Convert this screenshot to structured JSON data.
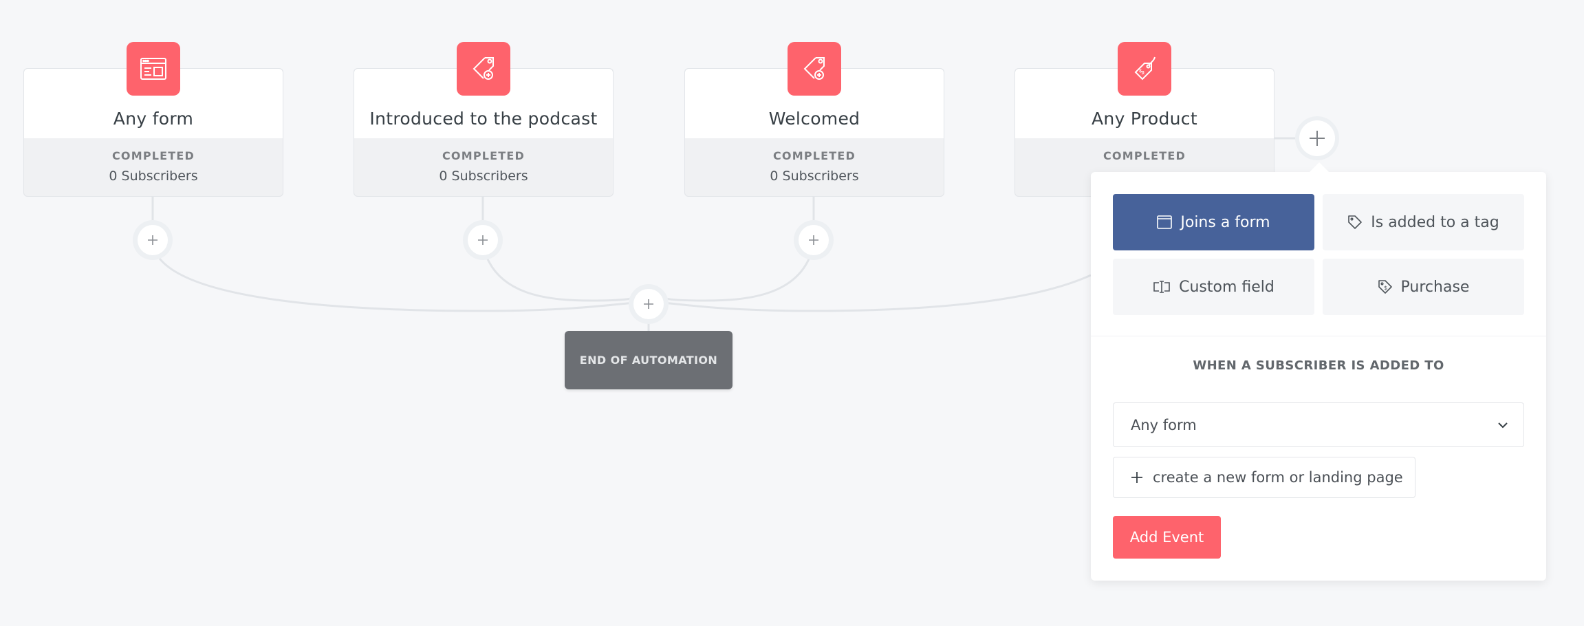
{
  "colors": {
    "accent": "#fe636c",
    "active_option": "#47629a",
    "end_box": "#6c6f74",
    "background": "#f6f7f9"
  },
  "events": [
    {
      "icon": "form-window-icon",
      "title": "Any form",
      "status_label": "COMPLETED",
      "count": "0 Subscribers"
    },
    {
      "icon": "tag-add-icon",
      "title": "Introduced to the podcast",
      "status_label": "COMPLETED",
      "count": "0 Subscribers"
    },
    {
      "icon": "tag-add-icon",
      "title": "Welcomed",
      "status_label": "COMPLETED",
      "count": "0 Subscribers"
    },
    {
      "icon": "price-tag-icon",
      "title": "Any Product",
      "status_label": "COMPLETED",
      "count": ""
    }
  ],
  "end_of_automation": "END OF AUTOMATION",
  "panel": {
    "options": [
      {
        "icon": "form-window-icon",
        "label": "Joins a form",
        "active": true
      },
      {
        "icon": "tag-icon",
        "label": "Is added to a tag",
        "active": false
      },
      {
        "icon": "custom-field-icon",
        "label": "Custom field",
        "active": false
      },
      {
        "icon": "price-tag-icon",
        "label": "Purchase",
        "active": false
      }
    ],
    "heading": "WHEN A SUBSCRIBER IS ADDED TO",
    "select_value": "Any form",
    "create_link": "create a new form or landing page",
    "submit_label": "Add Event"
  }
}
